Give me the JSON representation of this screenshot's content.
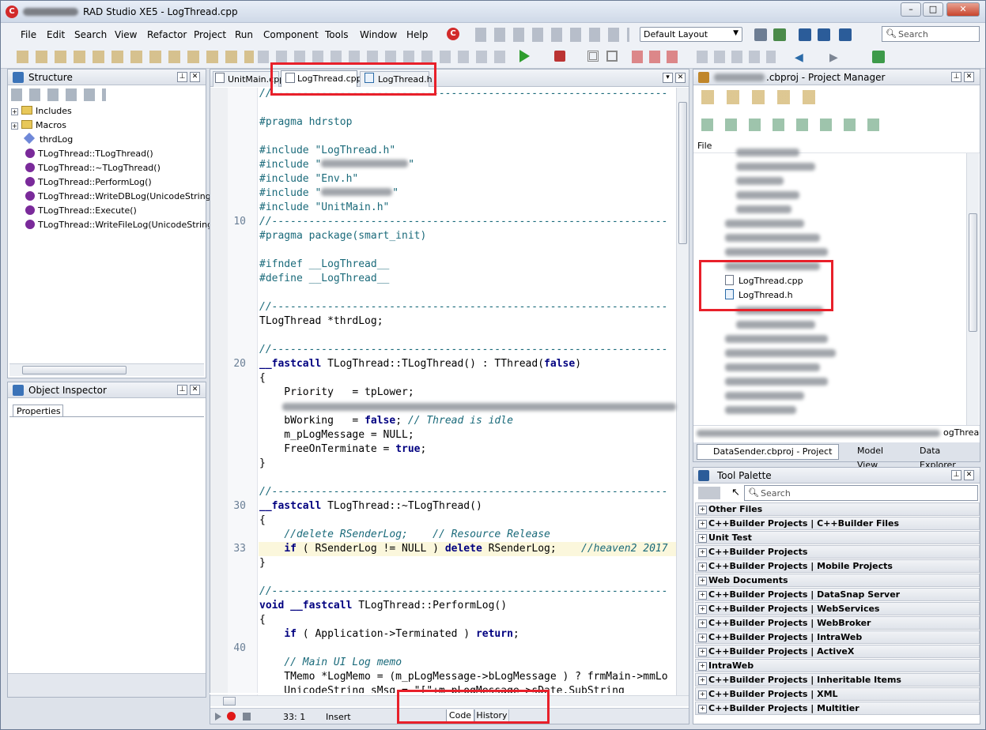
{
  "window": {
    "title": "RAD Studio XE5 - LogThread.cpp",
    "minimize": "–",
    "maximize": "□",
    "close": "✕"
  },
  "menu": [
    "File",
    "Edit",
    "Search",
    "View",
    "Refactor",
    "Project",
    "Run",
    "Component",
    "Tools",
    "Window",
    "Help"
  ],
  "layout_select": "Default Layout",
  "search_placeholder": "Search",
  "structure": {
    "title": "Structure",
    "items": [
      "Includes",
      "Macros",
      "thrdLog",
      "TLogThread::TLogThread()",
      "TLogThread::~TLogThread()",
      "TLogThread::PerformLog()",
      "TLogThread::WriteDBLog(UnicodeString sDa",
      "TLogThread::Execute()",
      "TLogThread::WriteFileLog(UnicodeString sPa"
    ]
  },
  "object_inspector": {
    "title": "Object Inspector",
    "tab": "Properties"
  },
  "editor": {
    "tabs": [
      "UnitMain.cpp",
      "LogThread.cpp",
      "LogThread.h"
    ],
    "bottom_tabs": [
      "Code",
      "History"
    ],
    "status": {
      "pos": "33:  1",
      "mode": "Insert"
    },
    "line_numbers": [
      {
        "n": "10",
        "row": 9
      },
      {
        "n": "20",
        "row": 19
      },
      {
        "n": "30",
        "row": 29
      },
      {
        "n": "33",
        "row": 32
      },
      {
        "n": "40",
        "row": 39
      }
    ]
  },
  "project_manager": {
    "title": ".cbproj - Project Manager",
    "column": "File",
    "files": [
      "LogThread.cpp",
      "LogThread.h"
    ],
    "path_tail": "ogThread",
    "tabs": [
      "DataSender.cbproj - Project ...",
      "Model View",
      "Data Explorer"
    ]
  },
  "tool_palette": {
    "title": "Tool Palette",
    "search_placeholder": "Search",
    "categories": [
      "Other Files",
      "C++Builder Projects | C++Builder Files",
      "Unit Test",
      "C++Builder Projects",
      "C++Builder Projects | Mobile Projects",
      "Web Documents",
      "C++Builder Projects | DataSnap Server",
      "C++Builder Projects | WebServices",
      "C++Builder Projects | WebBroker",
      "C++Builder Projects | IntraWeb",
      "C++Builder Projects | ActiveX",
      "IntraWeb",
      "C++Builder Projects | Inheritable Items",
      "C++Builder Projects | XML",
      "C++Builder Projects | Multitier"
    ]
  }
}
